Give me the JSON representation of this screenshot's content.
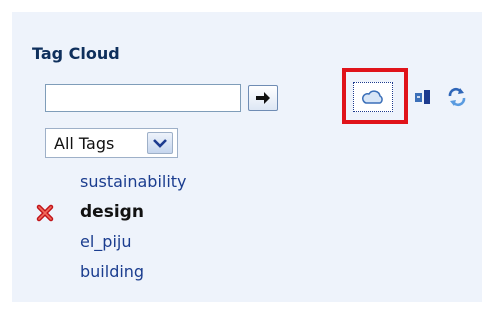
{
  "widget": {
    "title": "Tag Cloud",
    "search": {
      "value": "",
      "placeholder": ""
    },
    "go_icon": "arrow-right-icon",
    "filter": {
      "selected": "All Tags"
    },
    "toolbar": {
      "cloud_icon": "tag-cloud-view-icon",
      "list_icon": "tag-list-view-icon",
      "refresh_icon": "refresh-icon"
    },
    "tags": [
      {
        "label": "sustainability",
        "selected": false
      },
      {
        "label": "design",
        "selected": true
      },
      {
        "label": "el_piju",
        "selected": false
      },
      {
        "label": "building",
        "selected": false
      }
    ]
  },
  "colors": {
    "highlight": "#e0131a",
    "link": "#1b3d8f",
    "title": "#0e2f5c"
  }
}
